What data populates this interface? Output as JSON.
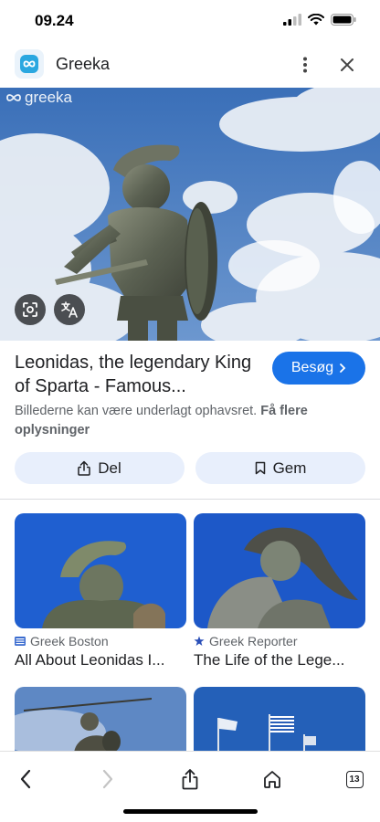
{
  "status_bar": {
    "time": "09.24"
  },
  "header": {
    "title": "Greeka",
    "logo_icon": "greeka-logo-icon"
  },
  "hero": {
    "watermark": "greeka"
  },
  "result": {
    "title": "Leonidas, the legendary King of Sparta - Famous...",
    "visit_label": "Besøg",
    "copyright_text": "Billederne kan være underlagt ophavsret.",
    "more_info_link": "Få flere oplysninger",
    "share_label": "Del",
    "save_label": "Gem"
  },
  "related": [
    {
      "source": "Greek Boston",
      "title": "All About Leonidas I...",
      "source_icon": "greek-boston-favicon"
    },
    {
      "source": "Greek Reporter",
      "title": "The Life of the Lege...",
      "source_icon": "greek-reporter-favicon"
    }
  ],
  "bottom_nav": {
    "tab_count": "13"
  },
  "colors": {
    "accent": "#1a73e8",
    "chip_bg": "#e8effc",
    "sky": "#2f6fd6"
  }
}
